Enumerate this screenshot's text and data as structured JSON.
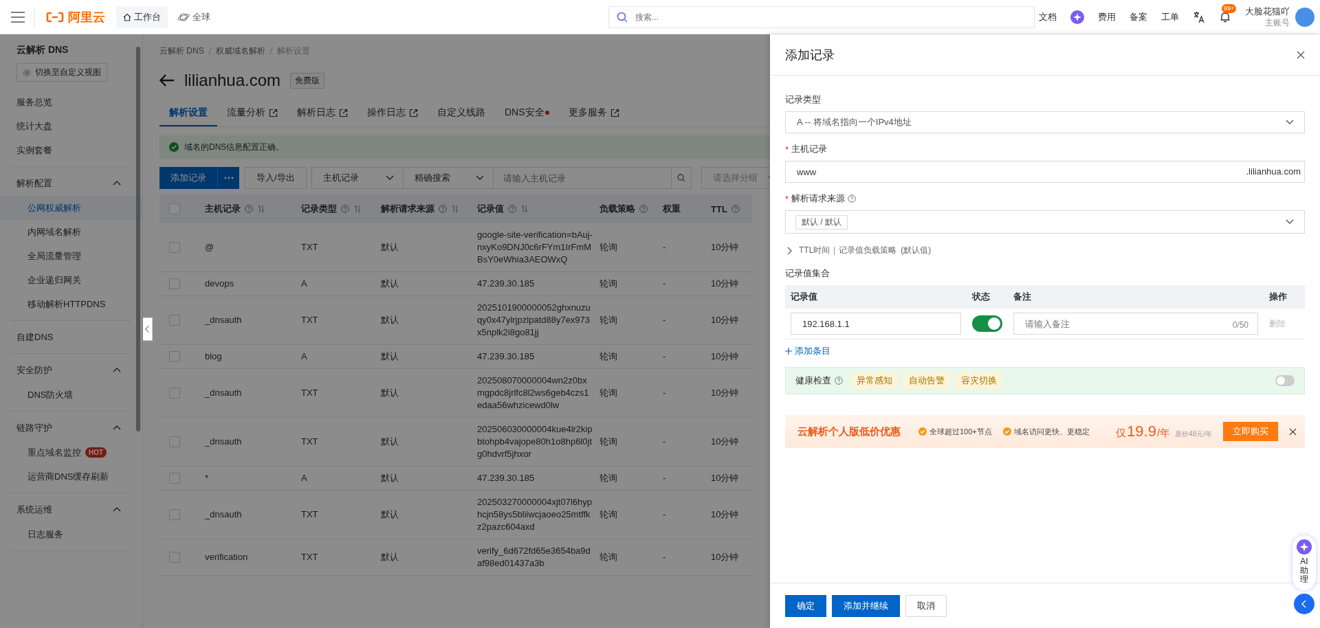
{
  "topbar": {
    "logo": "阿里云",
    "workbench": "工作台",
    "region": "全球",
    "search": {
      "placeholder": "搜索..."
    },
    "links": [
      "文档",
      "费用",
      "备案",
      "工单"
    ],
    "notification_badge": "99+",
    "user": {
      "name": "大脸花猫吖",
      "role": "主账号"
    }
  },
  "sidebar": {
    "title": "云解析 DNS",
    "view_button": "切换至自定义视图",
    "groups": [
      {
        "items": [
          {
            "label": "服务总览",
            "selected": false
          },
          {
            "label": "统计大盘",
            "selected": false
          },
          {
            "label": "实例套餐",
            "selected": false
          }
        ]
      },
      {
        "title": "解析配置",
        "expanded": true,
        "items": [
          {
            "label": "公网权威解析",
            "selected": true
          },
          {
            "label": "内网域名解析",
            "selected": false
          },
          {
            "label": "全局流量管理",
            "selected": false
          },
          {
            "label": "企业递归网关",
            "selected": false
          },
          {
            "label": "移动解析HTTPDNS",
            "selected": false
          }
        ]
      },
      {
        "items": [
          {
            "label": "自建DNS",
            "selected": false
          }
        ]
      },
      {
        "title": "安全防护",
        "expanded": true,
        "items": [
          {
            "label": "DNS防火墙",
            "selected": false
          }
        ]
      },
      {
        "title": "链路守护",
        "expanded": true,
        "items": [
          {
            "label": "重点域名监控",
            "selected": false,
            "badge": "HOT"
          },
          {
            "label": "运营商DNS缓存刷新",
            "selected": false
          }
        ]
      },
      {
        "title": "系统运维",
        "expanded": true,
        "items": [
          {
            "label": "日志服务",
            "selected": false
          }
        ]
      }
    ]
  },
  "main": {
    "breadcrumb": [
      "云解析 DNS",
      "权威域名解析",
      "解析设置"
    ],
    "title": "lilianhua.com",
    "edition": "免费版",
    "tabs": [
      {
        "label": "解析设置",
        "selected": true,
        "external": false,
        "dot": false
      },
      {
        "label": "流量分析",
        "selected": false,
        "external": true,
        "dot": false
      },
      {
        "label": "解析日志",
        "selected": false,
        "external": true,
        "dot": false
      },
      {
        "label": "操作日志",
        "selected": false,
        "external": true,
        "dot": false
      },
      {
        "label": "自定义线路",
        "selected": false,
        "external": false,
        "dot": false
      },
      {
        "label": "DNS安全",
        "selected": false,
        "external": false,
        "dot": true
      },
      {
        "label": "更多服务",
        "selected": false,
        "external": true,
        "dot": false
      }
    ],
    "alert": "域名的DNS信息配置正确。",
    "toolbar": {
      "add_button": "添加记录",
      "import_export": "导入/导出",
      "field_select": "主机记录",
      "match_select": "精确搜索",
      "search": {
        "placeholder": "请输入主机记录"
      },
      "group_select": {
        "placeholder": "请选择分组"
      }
    },
    "table": {
      "all_checked": false,
      "columns": [
        {
          "label": "主机记录",
          "help": true,
          "sortable": true
        },
        {
          "label": "记录类型",
          "help": true,
          "sortable": true
        },
        {
          "label": "解析请求来源",
          "help": true,
          "sortable": true
        },
        {
          "label": "记录值",
          "help": true,
          "sortable": true
        },
        {
          "label": "负载策略",
          "help": true
        },
        {
          "label": "权重"
        },
        {
          "label": "TTL",
          "help": true
        }
      ],
      "rows": [
        {
          "checked": false,
          "host": "@",
          "type": "TXT",
          "source": "默认",
          "value": "google-site-verification=bAuj-nxyKo9DNJ0c6rFYm1IrFmMBsY0eWhia3AEOWxQ",
          "policy": "轮询",
          "weight": "-",
          "ttl": "10分钟"
        },
        {
          "checked": false,
          "host": "devops",
          "type": "A",
          "source": "默认",
          "value": "47.239.30.185",
          "policy": "轮询",
          "weight": "-",
          "ttl": "10分钟"
        },
        {
          "checked": false,
          "host": "_dnsauth",
          "type": "TXT",
          "source": "默认",
          "value": "2025101900000052ghxnuzuqy0x47ylrjpzlpatd88y7ex973x5nplk2i8go81jj",
          "policy": "轮询",
          "weight": "-",
          "ttl": "10分钟"
        },
        {
          "checked": false,
          "host": "blog",
          "type": "A",
          "source": "默认",
          "value": "47.239.30.185",
          "policy": "轮询",
          "weight": "-",
          "ttl": "10分钟"
        },
        {
          "checked": false,
          "host": "_dnsauth",
          "type": "TXT",
          "source": "默认",
          "value": "202508070000004wn2z0bxmgpdc8jrlfc8l2ws6geb4czs1edaa56whzicewd0lw",
          "policy": "轮询",
          "weight": "-",
          "ttl": "10分钟"
        },
        {
          "checked": false,
          "host": "_dnsauth",
          "type": "TXT",
          "source": "默认",
          "value": "202506030000004kue4lr2kipbtohpb4vajope80h1o8hp6l0jtg0hdvrf5jhxor",
          "policy": "轮询",
          "weight": "-",
          "ttl": "10分钟"
        },
        {
          "checked": false,
          "host": "*",
          "type": "A",
          "source": "默认",
          "value": "47.239.30.185",
          "policy": "轮询",
          "weight": "-",
          "ttl": "10分钟"
        },
        {
          "checked": false,
          "host": "_dnsauth",
          "type": "TXT",
          "source": "默认",
          "value": "202503270000004xjt07l6hyphcjn58ys5bliiwcjaoeo25mtffkz2pazc604axd",
          "policy": "轮询",
          "weight": "-",
          "ttl": "10分钟"
        },
        {
          "checked": false,
          "host": "verification",
          "type": "TXT",
          "source": "默认",
          "value": "verify_6d672fd65e3654ba9daf98ed01437a3b",
          "policy": "轮询",
          "weight": "-",
          "ttl": "10分钟"
        }
      ]
    }
  },
  "drawer": {
    "title": "添加记录",
    "record_type": {
      "label": "记录类型",
      "value": "A -- 将域名指向一个IPv4地址"
    },
    "host": {
      "label": "主机记录",
      "required": true,
      "value": "www",
      "suffix": ".lilianhua.com"
    },
    "source": {
      "label": "解析请求来源",
      "required": true,
      "tag": "默认 / 默认"
    },
    "advanced": {
      "expanded": false,
      "items": [
        "TTL时间",
        "记录值负载策略"
      ],
      "note": "(默认值)"
    },
    "values": {
      "title": "记录值集合",
      "columns": [
        "记录值",
        "状态",
        "备注",
        "操作"
      ],
      "rows": [
        {
          "value": "192.168.1.1",
          "on": true,
          "note_placeholder": "请输入备注",
          "counter": "0/50",
          "action": "删除"
        }
      ],
      "add_link": "添加条目"
    },
    "health_check": {
      "label": "健康检查",
      "tags": [
        "异常感知",
        "自动告警",
        "容灾切换"
      ],
      "on": false
    },
    "promo": {
      "title": "云解析个人版低价优惠",
      "features": [
        "全球超过100+节点",
        "域名访问更快、更稳定"
      ],
      "price_prefix": "仅",
      "price": "19.9",
      "unit": "/年",
      "original": "原价48元/年",
      "button": "立即购买"
    },
    "buttons": [
      {
        "label": "确定",
        "kind": "primary"
      },
      {
        "label": "添加并继续",
        "kind": "primary"
      },
      {
        "label": "取消",
        "kind": "default"
      }
    ]
  },
  "assistant": {
    "label": "AI助理"
  }
}
